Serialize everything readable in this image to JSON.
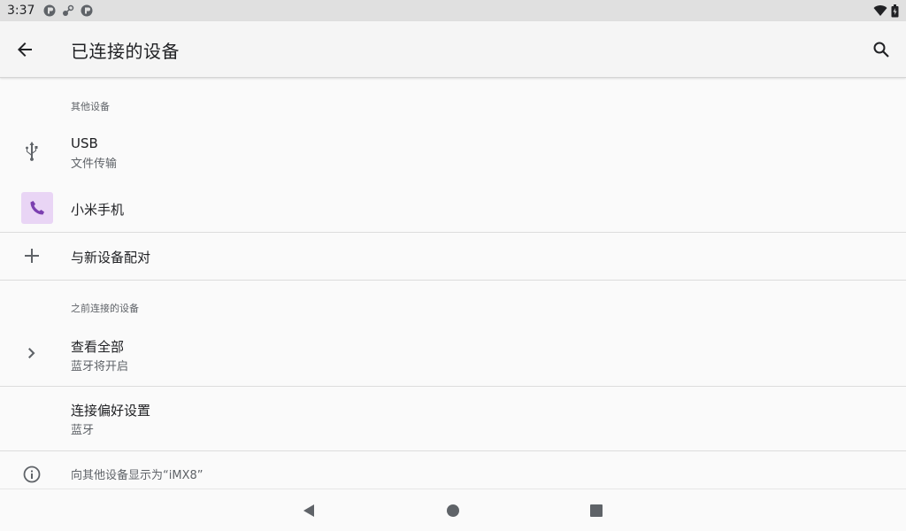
{
  "status_bar": {
    "time": "3:37",
    "icons_left": [
      "notification-icon",
      "settings-notification-icon",
      "notification-icon"
    ],
    "icons_right": [
      "wifi-icon",
      "battery-icon"
    ]
  },
  "app_bar": {
    "title": "已连接的设备",
    "back_icon": "arrow-back-icon",
    "search_icon": "search-icon"
  },
  "sections": {
    "other_devices": {
      "header": "其他设备",
      "items": [
        {
          "icon": "usb-icon",
          "primary": "USB",
          "secondary": "文件传输"
        },
        {
          "icon": "phone-icon",
          "primary": "小米手机",
          "secondary": ""
        }
      ]
    },
    "pair_new": {
      "icon": "plus-icon",
      "label": "与新设备配对"
    },
    "previous_devices": {
      "header": "之前连接的设备",
      "see_all": {
        "icon": "chevron-right-icon",
        "primary": "查看全部",
        "secondary": "蓝牙将开启"
      }
    },
    "connection_prefs": {
      "primary": "连接偏好设置",
      "secondary": "蓝牙"
    },
    "footer": {
      "icon": "info-icon",
      "text": "向其他设备显示为“iMX8”"
    }
  },
  "nav_bar": {
    "back": "nav-back-icon",
    "home": "nav-home-icon",
    "recents": "nav-recents-icon"
  },
  "colors": {
    "accent_purple": "#7b3fb0",
    "phone_bg": "#e9d5f5",
    "text_primary": "#202124",
    "text_secondary": "#5f6368"
  }
}
